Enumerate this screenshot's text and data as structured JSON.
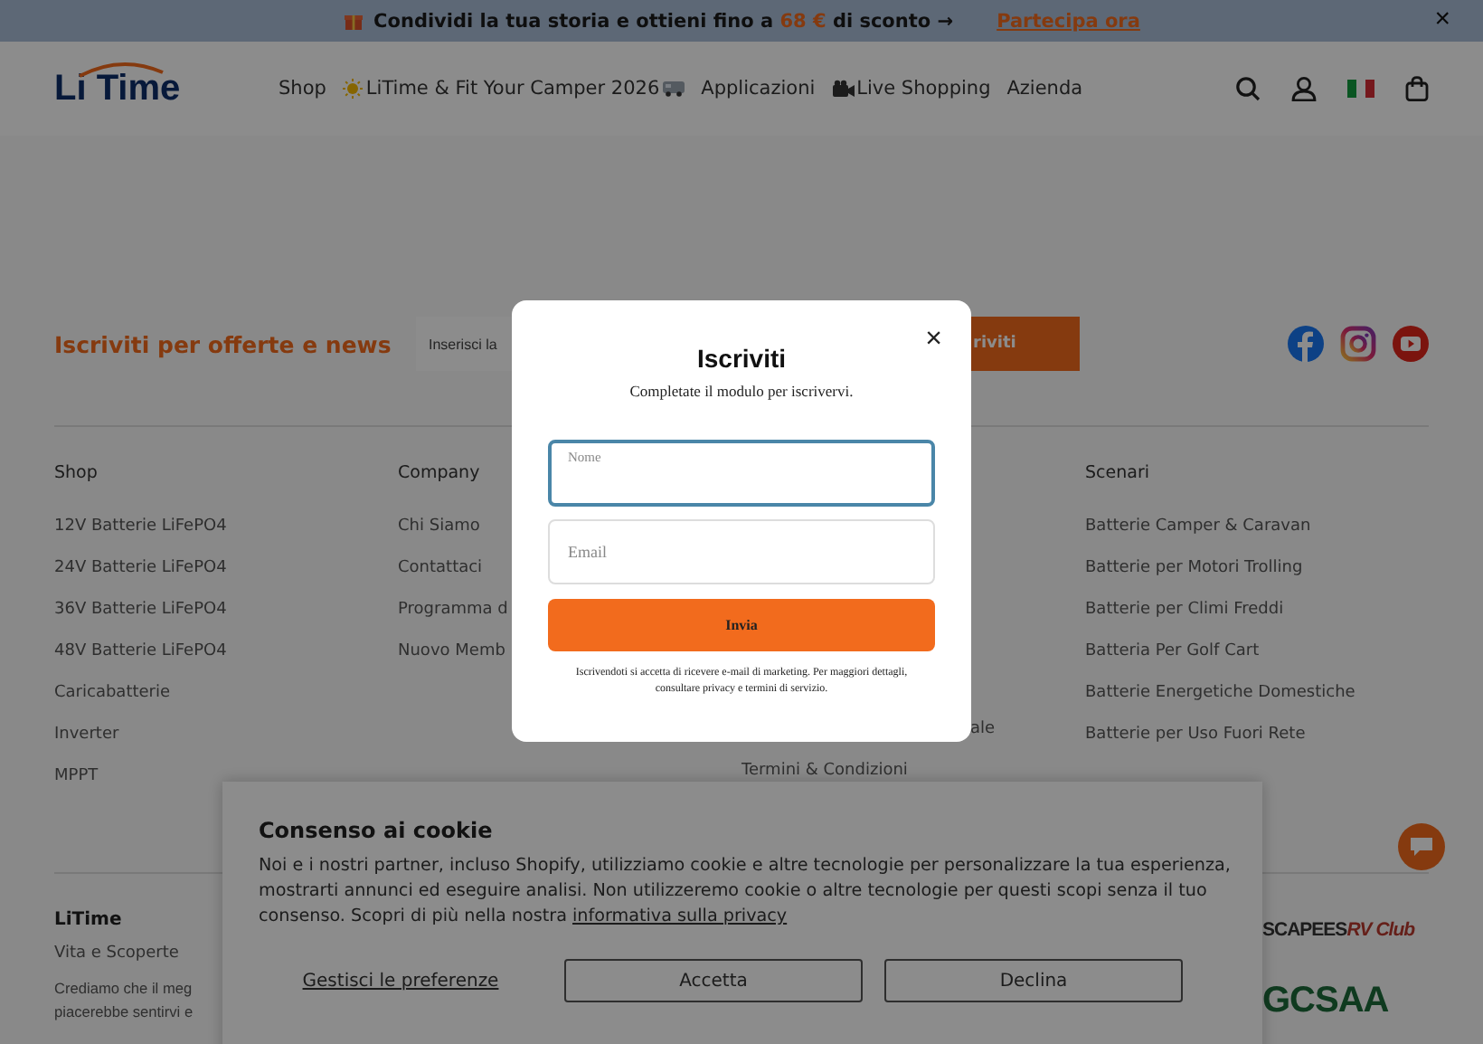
{
  "announcement": {
    "text_before": "Condividi la tua storia e ottieni fino a",
    "highlight": "68 €",
    "text_after": "di sconto →",
    "link": "Partecipa ora",
    "close": "×"
  },
  "header": {
    "logo": "Li Time",
    "nav": [
      {
        "label": "Shop",
        "kind": "plain"
      },
      {
        "label": "LiTime & Fit Your Camper 2026",
        "kind": "promo"
      },
      {
        "label": "Applicazioni",
        "kind": "plain"
      },
      {
        "label": "Live Shopping",
        "kind": "live"
      },
      {
        "label": "Azienda",
        "kind": "plain"
      }
    ]
  },
  "newsletter": {
    "heading": "Iscriviti per offerte e news",
    "placeholder": "Inserisci la",
    "button": "riviti"
  },
  "footer": {
    "columns": [
      {
        "heading": "Shop",
        "items": [
          "12V Batterie LiFePO4",
          "24V Batterie LiFePO4",
          "36V Batterie LiFePO4",
          "48V Batterie LiFePO4",
          "Caricabatterie",
          "Inverter",
          "MPPT"
        ]
      },
      {
        "heading": "Company",
        "items": [
          "Chi Siamo",
          "Contattaci",
          "Programma d",
          "Nuovo Memb"
        ]
      },
      {
        "items": [
          "ale",
          "Termini & Condizioni"
        ]
      },
      {
        "heading": "Scenari",
        "items": [
          "Batterie Camper & Caravan",
          "Batterie per Motori Trolling",
          "Batterie per Climi Freddi",
          "Batteria Per Golf Cart",
          "Batterie Energetiche Domestiche",
          "Batterie per Uso Fuori Rete"
        ]
      }
    ],
    "about": {
      "heading": "LiTime",
      "subheading": "Vita e Scoperte",
      "lines": [
        "Crediamo che il meg",
        "piacerebbe sentirvi e"
      ]
    },
    "partners": [
      {
        "name": "SCAPEES",
        "tag": "RV Club"
      },
      {
        "name": "GCSAA"
      }
    ]
  },
  "cookie_banner": {
    "title": "Consenso ai cookie",
    "text": "Noi e i nostri partner, incluso Shopify, utilizziamo cookie e altre tecnologie per personalizzare la tua esperienza, mostrarti annunci ed eseguire analisi. Non utilizzeremo cookie o altre tecnologie per questi scopi senza il tuo consenso. Scopri di più nella nostra",
    "link": "informativa sulla privacy",
    "buttons": [
      {
        "label": "Gestisci le preferenze",
        "kind": "link"
      },
      {
        "label": "Accetta",
        "kind": "outline"
      },
      {
        "label": "Declina",
        "kind": "outline"
      }
    ]
  },
  "modal": {
    "title": "Iscriviti",
    "subtitle": "Completate il modulo per iscrivervi.",
    "close": "×",
    "fields": [
      {
        "placeholder": "Nome",
        "focused": true
      },
      {
        "placeholder": "Email",
        "focused": false
      }
    ],
    "button": "Invia",
    "disclaimer": "Iscrivendoti si accetta di ricevere e-mail di marketing. Per maggiori dettagli, consultare privacy e termini di servizio."
  }
}
